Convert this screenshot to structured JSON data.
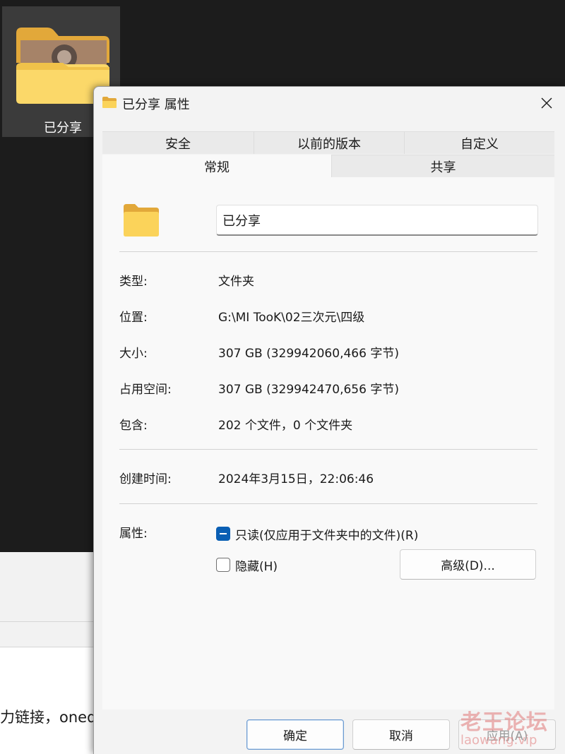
{
  "desktop": {
    "icon_label": "已分享",
    "background_text": "力链接，oned"
  },
  "dialog": {
    "title": "已分享 属性",
    "tabs_row1": [
      "安全",
      "以前的版本",
      "自定义"
    ],
    "tabs_row2": [
      "常规",
      "共享"
    ],
    "active_tab": "常规",
    "folder_name": "已分享",
    "properties": {
      "type": {
        "label": "类型:",
        "value": "文件夹"
      },
      "location": {
        "label": "位置:",
        "value": "G:\\MI TooK\\02三次元\\四级"
      },
      "size": {
        "label": "大小:",
        "value": "307 GB (329942060,466 字节)"
      },
      "size_on_disk": {
        "label": "占用空间:",
        "value": "307 GB (329942470,656 字节)"
      },
      "contains": {
        "label": "包含:",
        "value": "202 个文件，0 个文件夹"
      },
      "created": {
        "label": "创建时间:",
        "value": "2024年3月15日，22:06:46"
      }
    },
    "attributes": {
      "label": "属性:",
      "readonly": {
        "label": "只读(仅应用于文件夹中的文件)(R)",
        "state": "indeterminate"
      },
      "hidden": {
        "label": "隐藏(H)",
        "state": "unchecked"
      },
      "advanced_button": "高级(D)..."
    },
    "buttons": {
      "ok": "确定",
      "cancel": "取消",
      "apply": "应用(A)"
    }
  },
  "watermark": {
    "main": "老王论坛",
    "sub": "laowang.vip"
  },
  "colors": {
    "accent": "#0a5fb4",
    "folder_yellow": "#f7c948",
    "dialog_bg": "#f3f3f3"
  }
}
